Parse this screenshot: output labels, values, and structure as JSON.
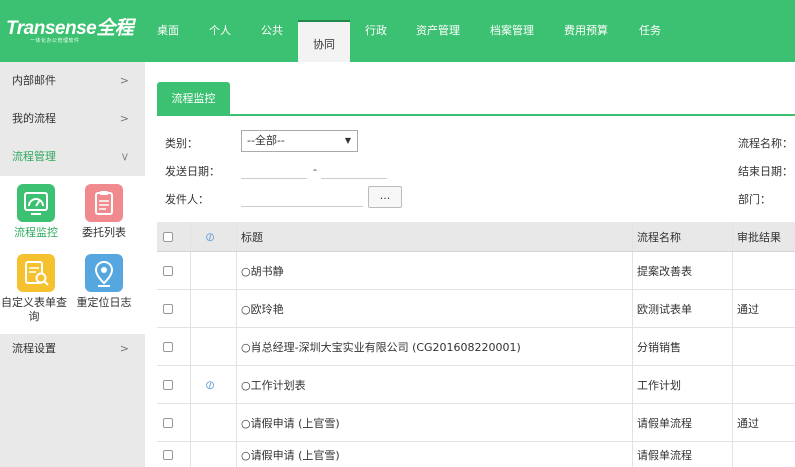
{
  "logo": {
    "main": "Transense全程",
    "sub": "一体化办公管理软件"
  },
  "nav": [
    {
      "label": "桌面"
    },
    {
      "label": "个人"
    },
    {
      "label": "公共"
    },
    {
      "label": "协同"
    },
    {
      "label": "行政"
    },
    {
      "label": "资产管理"
    },
    {
      "label": "档案管理"
    },
    {
      "label": "费用预算"
    },
    {
      "label": "任务"
    }
  ],
  "sidebar": {
    "items": [
      {
        "label": "内部邮件"
      },
      {
        "label": "我的流程"
      },
      {
        "label": "流程管理"
      },
      {
        "label": "流程设置"
      }
    ],
    "tiles": [
      {
        "label": "流程监控",
        "icon": "monitor-icon",
        "color": "#3cc071"
      },
      {
        "label": "委托列表",
        "icon": "clipboard-icon",
        "color": "#f08a8e"
      },
      {
        "label": "自定义表单查询",
        "icon": "form-search-icon",
        "color": "#f5c12f"
      },
      {
        "label": "重定位日志",
        "icon": "location-pin-icon",
        "color": "#56a6e0"
      }
    ]
  },
  "content": {
    "tab": "流程监控",
    "filters": {
      "category_label": "类别：",
      "category_value": "--全部--",
      "send_date_label": "发送日期：",
      "date_sep": "-",
      "sender_label": "发件人：",
      "browse_label": "...",
      "flow_name_label": "流程名称：",
      "end_date_label": "结束日期：",
      "dept_label": "部门："
    },
    "table": {
      "headers": {
        "title": "标题",
        "flow_name": "流程名称",
        "result": "审批结果"
      },
      "rows": [
        {
          "title": "○胡书静",
          "flow_name": "提案改善表",
          "result": "",
          "attach": false
        },
        {
          "title": "○欧玲艳",
          "flow_name": "欧测试表单",
          "result": "通过",
          "attach": false
        },
        {
          "title": "○肖总经理-深圳大宝实业有限公司 (CG201608220001)",
          "flow_name": "分销销售",
          "result": "",
          "attach": false
        },
        {
          "title": "○工作计划表",
          "flow_name": "工作计划",
          "result": "",
          "attach": true
        },
        {
          "title": "○请假申请 (上官雪)",
          "flow_name": "请假单流程",
          "result": "通过",
          "attach": false
        },
        {
          "title": "○请假申请 (上官雪)",
          "flow_name": "请假单流程",
          "result": "",
          "attach": false
        }
      ]
    }
  },
  "colors": {
    "brand": "#3cc071",
    "accent_text": "#2eaa5e"
  }
}
